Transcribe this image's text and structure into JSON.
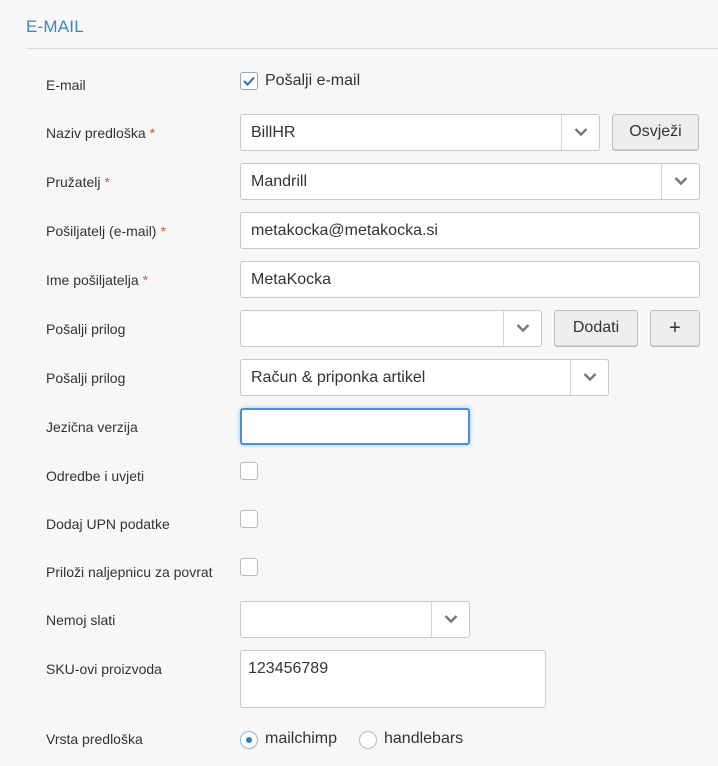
{
  "section": {
    "title": "E-MAIL"
  },
  "fields": {
    "email": {
      "label": "E-mail",
      "checkbox_label": "Pošalji e-mail",
      "checked": true
    },
    "template_name": {
      "label": "Naziv predloška",
      "required_mark": "*",
      "value": "BillHR",
      "button": "Osvježi"
    },
    "provider": {
      "label": "Pružatelj",
      "required_mark": "*",
      "value": "Mandrill"
    },
    "sender_email": {
      "label": "Pošiljatelj (e-mail)",
      "required_mark": "*",
      "value": "metakocka@metakocka.si"
    },
    "sender_name": {
      "label": "Ime pošiljatelja",
      "required_mark": "*",
      "value": "MetaKocka"
    },
    "attachment_1": {
      "label": "Pošalji prilog",
      "value": "",
      "button": "Dodati",
      "plus": "+"
    },
    "attachment_2": {
      "label": "Pošalji prilog",
      "value": "Račun & priponka artikel"
    },
    "language": {
      "label": "Jezična verzija",
      "value": ""
    },
    "terms": {
      "label": "Odredbe i uvjeti",
      "checked": false
    },
    "upn": {
      "label": "Dodaj UPN podatke",
      "checked": false
    },
    "return_label": {
      "label": "Priloži naljepnicu za povrat",
      "checked": false
    },
    "do_not_send": {
      "label": "Nemoj slati",
      "value": ""
    },
    "sku": {
      "label": "SKU-ovi proizvoda",
      "value": "123456789"
    },
    "template_type": {
      "label": "Vrsta predloška",
      "options": [
        "mailchimp",
        "handlebars"
      ],
      "selected": "mailchimp"
    }
  },
  "colors": {
    "accent": "#3a87c8",
    "required": "#d9534f",
    "focus": "#2d7fc1"
  }
}
